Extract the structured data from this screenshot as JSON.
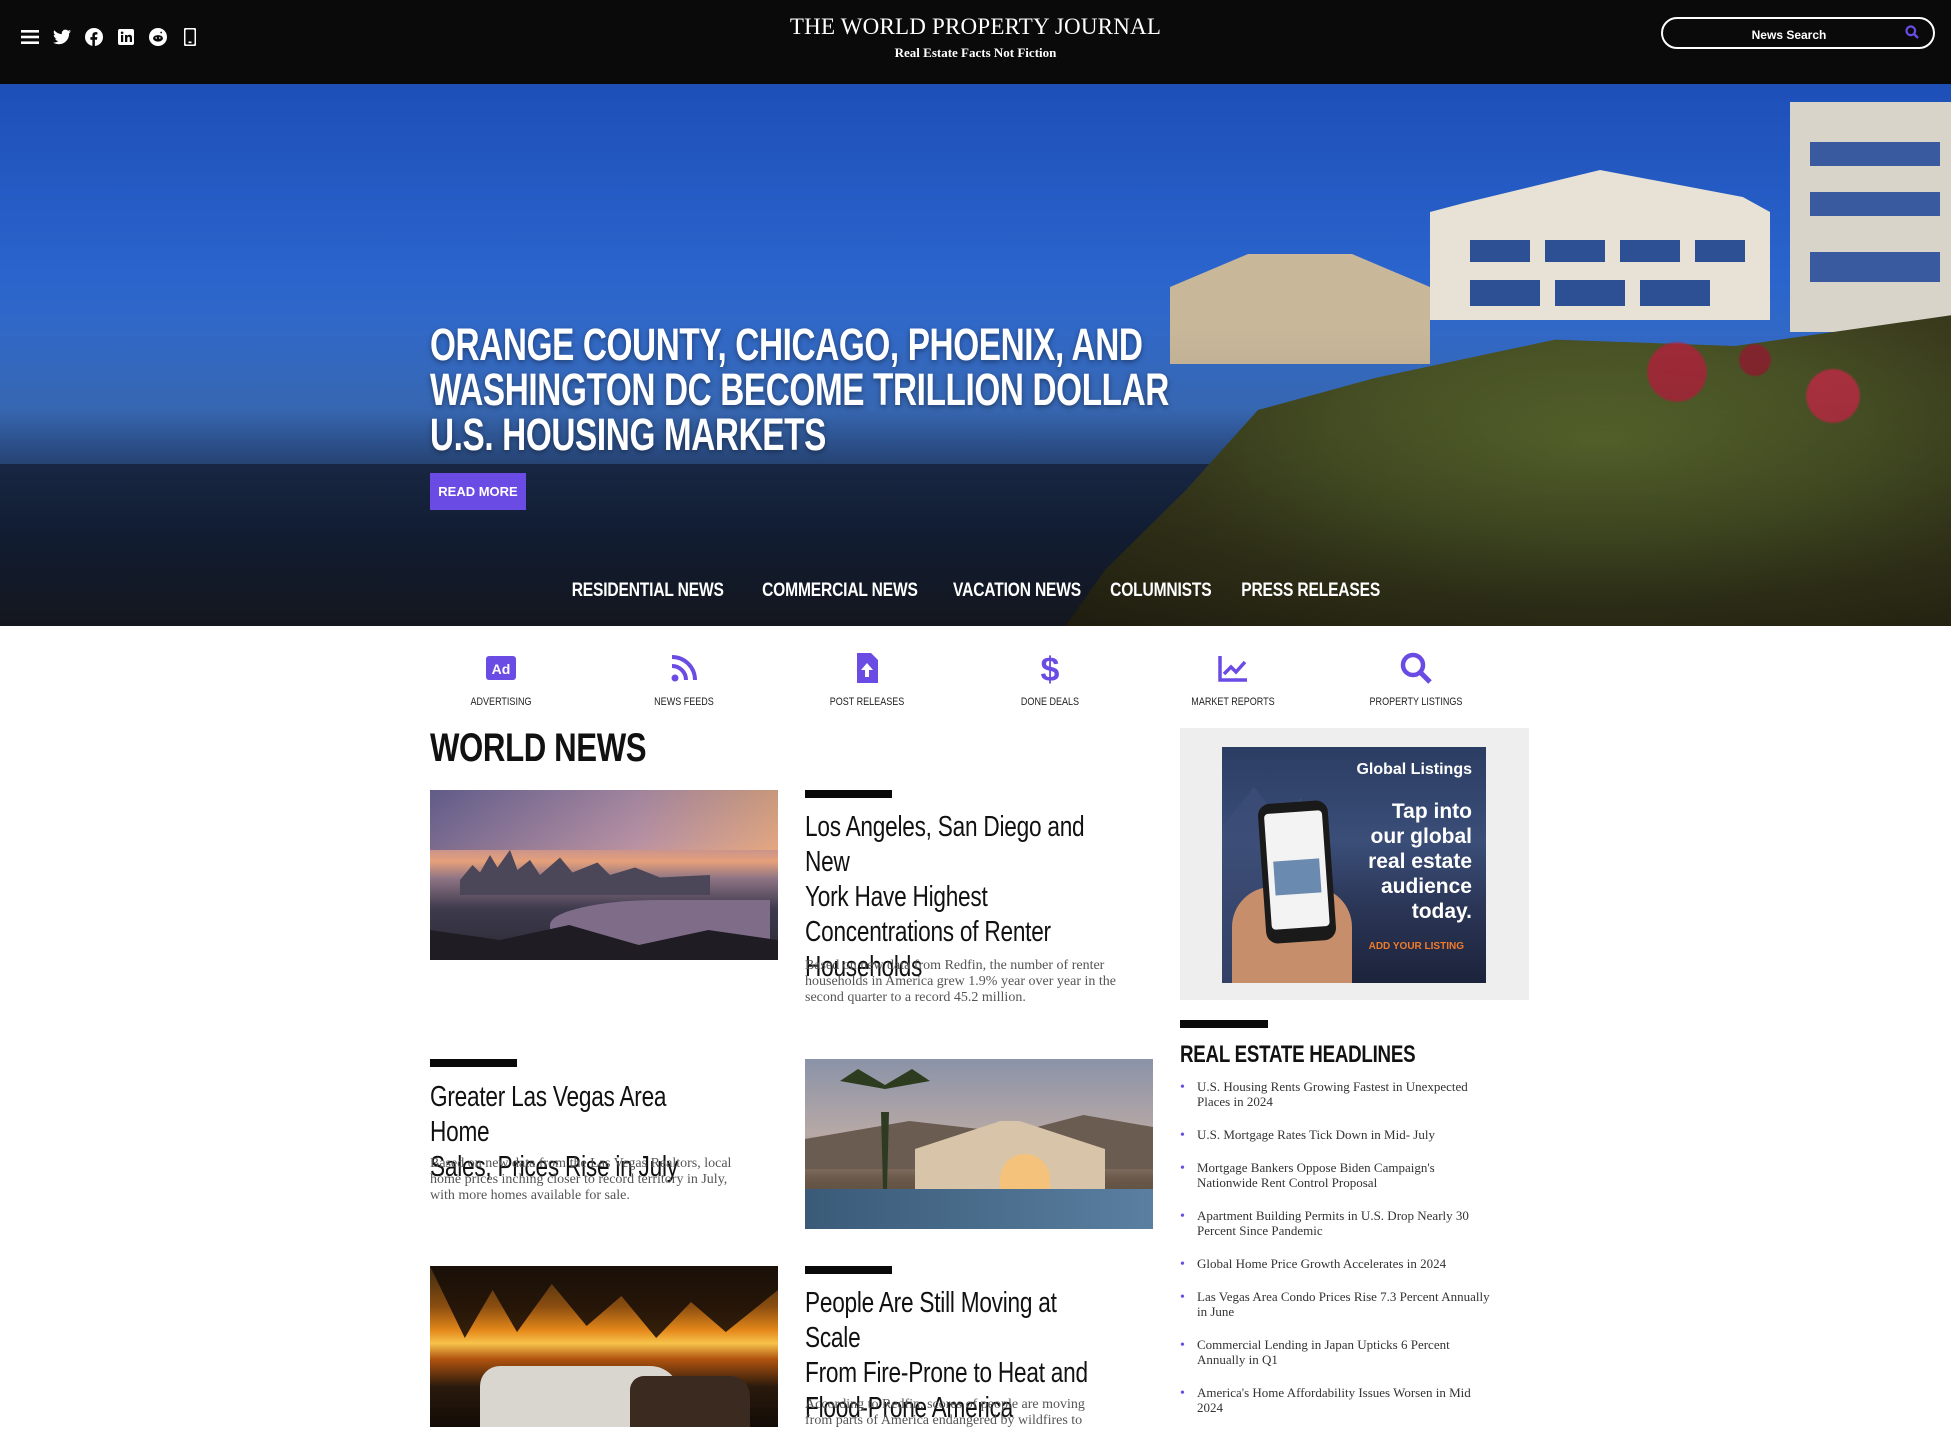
{
  "header": {
    "title": "THE WORLD PROPERTY JOURNAL",
    "tagline": "Real Estate Facts Not Fiction",
    "search_placeholder": "News Search",
    "icons": [
      "menu-icon",
      "twitter-icon",
      "facebook-icon",
      "linkedin-icon",
      "reddit-icon",
      "mobile-icon"
    ]
  },
  "hero": {
    "headline_lines": [
      "ORANGE COUNTY, CHICAGO, PHOENIX, AND",
      "WASHINGTON DC BECOME TRILLION DOLLAR",
      "U.S. HOUSING MARKETS"
    ],
    "read_more": "READ MORE"
  },
  "nav": {
    "items": [
      "RESIDENTIAL NEWS",
      "COMMERCIAL NEWS",
      "VACATION NEWS",
      "COLUMNISTS",
      "PRESS RELEASES"
    ]
  },
  "services": [
    {
      "label": "ADVERTISING",
      "icon": "ad-icon"
    },
    {
      "label": "NEWS FEEDS",
      "icon": "rss-icon"
    },
    {
      "label": "POST RELEASES",
      "icon": "file-upload-icon"
    },
    {
      "label": "DONE DEALS",
      "icon": "dollar-icon"
    },
    {
      "label": "MARKET REPORTS",
      "icon": "chart-line-icon"
    },
    {
      "label": "PROPERTY LISTINGS",
      "icon": "search-icon"
    }
  ],
  "world_news": {
    "title": "WORLD NEWS",
    "articles": [
      {
        "title": "Los Angeles, San Diego and New York Have Highest Concentrations of Renter Households",
        "title_lines": [
          "Los Angeles, San Diego and New",
          "York Have Highest",
          "Concentrations of Renter",
          "Households"
        ],
        "summary_lines": [
          "Based on new data from Redfin, the number of renter",
          "households in America grew 1.9% year over year in the",
          "second quarter to a record 45.2 million."
        ]
      },
      {
        "title": "Greater Las Vegas Area Home Sales, Prices Rise in July",
        "title_lines": [
          "Greater Las Vegas Area Home",
          "Sales, Prices Rise in July"
        ],
        "summary_lines": [
          "Based on new data from the Las Vegas Realtors, local",
          "home prices inching closer to record territory in July,",
          "with more homes available for sale."
        ]
      },
      {
        "title": "People Are Still Moving at Scale From Fire-Prone to Heat and Flood-Prone America",
        "title_lines": [
          "People Are Still Moving at Scale",
          "From Fire-Prone to Heat and",
          "Flood-Prone America"
        ],
        "summary_lines": [
          "According to Redfin, scores of people are moving",
          "from parts of America endangered by wildfires to"
        ]
      }
    ]
  },
  "ad": {
    "logo": "Global Listings",
    "tagline_lines": [
      "Tap into",
      "our global",
      "real estate",
      "audience",
      "today."
    ],
    "cta": "ADD YOUR LISTING"
  },
  "headlines": {
    "title": "REAL ESTATE HEADLINES",
    "items": [
      {
        "lines": [
          "U.S. Housing Rents Growing Fastest in Unexpected",
          "Places in 2024"
        ]
      },
      {
        "lines": [
          "U.S. Mortgage Rates Tick Down in Mid- July"
        ]
      },
      {
        "lines": [
          "Mortgage Bankers Oppose Biden Campaign's",
          "Nationwide Rent Control Proposal"
        ]
      },
      {
        "lines": [
          "Apartment Building Permits in U.S. Drop Nearly 30",
          "Percent Since Pandemic"
        ]
      },
      {
        "lines": [
          "Global Home Price Growth Accelerates in 2024"
        ]
      },
      {
        "lines": [
          "Las Vegas Area Condo Prices Rise 7.3 Percent Annually",
          "in June"
        ]
      },
      {
        "lines": [
          "Commercial Lending in Japan Upticks 6 Percent",
          "Annually in Q1"
        ]
      },
      {
        "lines": [
          "America's Home Affordability Issues Worsen in Mid",
          "2024"
        ]
      }
    ]
  },
  "colors": {
    "accent": "#6a4be3",
    "header_bg": "#0a0a0a",
    "sidebar_bg": "#eeeeee",
    "ad_cta": "#f07a2a"
  }
}
